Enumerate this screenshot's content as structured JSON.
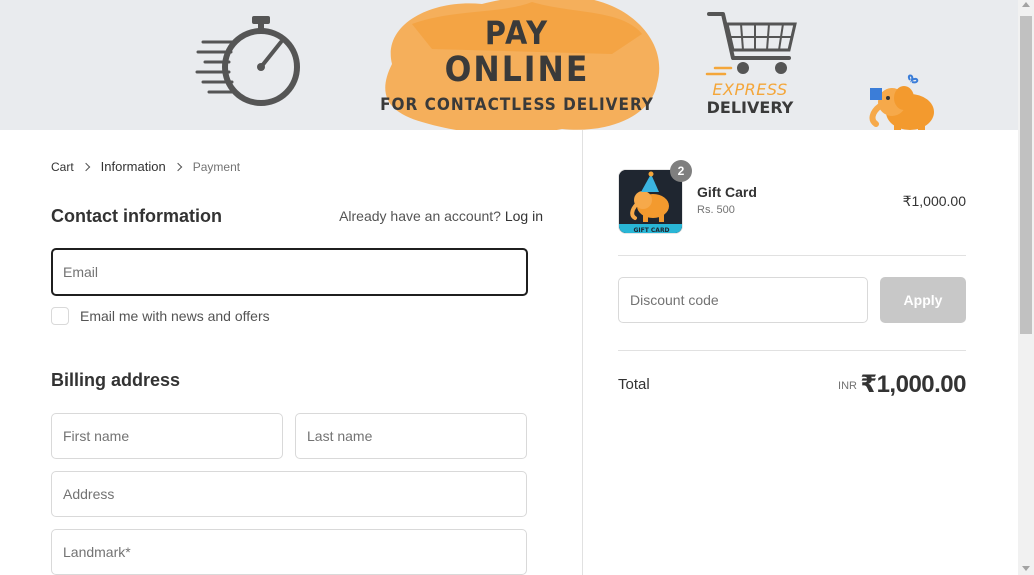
{
  "banner": {
    "line1": "PAY",
    "line2": "ONLINE",
    "line3": "FOR CONTACTLESS DELIVERY",
    "express": "EXPRESS",
    "delivery": "DELIVERY"
  },
  "breadcrumb": {
    "cart": "Cart",
    "information": "Information",
    "payment": "Payment"
  },
  "contact": {
    "title": "Contact information",
    "account_prompt": "Already have an account?",
    "login_link": "Log in",
    "email_placeholder": "Email",
    "newsletter_label": "Email me with news and offers"
  },
  "billing": {
    "title": "Billing address",
    "first_name_placeholder": "First name",
    "last_name_placeholder": "Last name",
    "address_placeholder": "Address",
    "landmark_placeholder": "Landmark*"
  },
  "summary": {
    "product_name": "Gift Card",
    "product_variant": "Rs. 500",
    "quantity": "2",
    "product_price": "₹1,000.00",
    "thumb_label": "GIFT CARD",
    "discount_placeholder": "Discount code",
    "apply_label": "Apply",
    "total_label": "Total",
    "total_currency": "INR",
    "total_value": "₹1,000.00"
  },
  "colors": {
    "accent_orange": "#f4a63a",
    "banner_bg": "#e9ebee",
    "apply_disabled": "#c8c8c8"
  }
}
